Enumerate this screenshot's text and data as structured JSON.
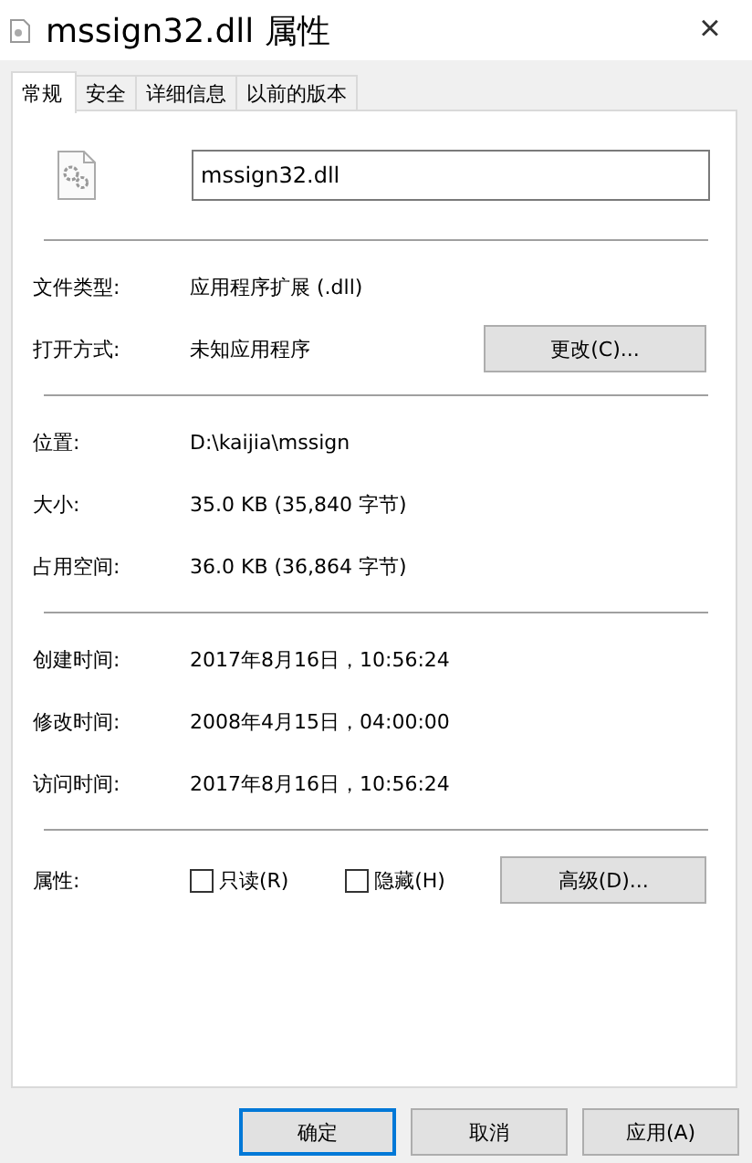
{
  "window": {
    "title": "mssign32.dll 属性",
    "close": "×"
  },
  "tabs": [
    {
      "label": "常规",
      "selected": true
    },
    {
      "label": "安全",
      "selected": false
    },
    {
      "label": "详细信息",
      "selected": false
    },
    {
      "label": "以前的版本",
      "selected": false
    }
  ],
  "file_name": {
    "value": "mssign32.dll"
  },
  "sections": [
    [
      {
        "label": "文件类型:",
        "value": "应用程序扩展 (.dll)"
      },
      {
        "label": "打开方式:",
        "value": "未知应用程序",
        "button": "更改(C)..."
      }
    ],
    [
      {
        "label": "位置:",
        "value": "D:\\kaijia\\mssign"
      },
      {
        "label": "大小:",
        "value": "35.0 KB (35,840 字节)"
      },
      {
        "label": "占用空间:",
        "value": "36.0 KB (36,864 字节)"
      }
    ],
    [
      {
        "label": "创建时间:",
        "value": "2017年8月16日，10:56:24"
      },
      {
        "label": "修改时间:",
        "value": "2008年4月15日，04:00:00"
      },
      {
        "label": "访问时间:",
        "value": "2017年8月16日，10:56:24"
      }
    ]
  ],
  "attributes": {
    "label": "属性:",
    "checkboxes": [
      {
        "label": "只读(R)",
        "checked": false
      },
      {
        "label": "隐藏(H)",
        "checked": false
      }
    ],
    "button": "高级(D)..."
  },
  "buttons": [
    {
      "label": "确定",
      "selected": true
    },
    {
      "label": "取消",
      "selected": false
    },
    {
      "label": "应用(A)",
      "selected": false
    }
  ]
}
